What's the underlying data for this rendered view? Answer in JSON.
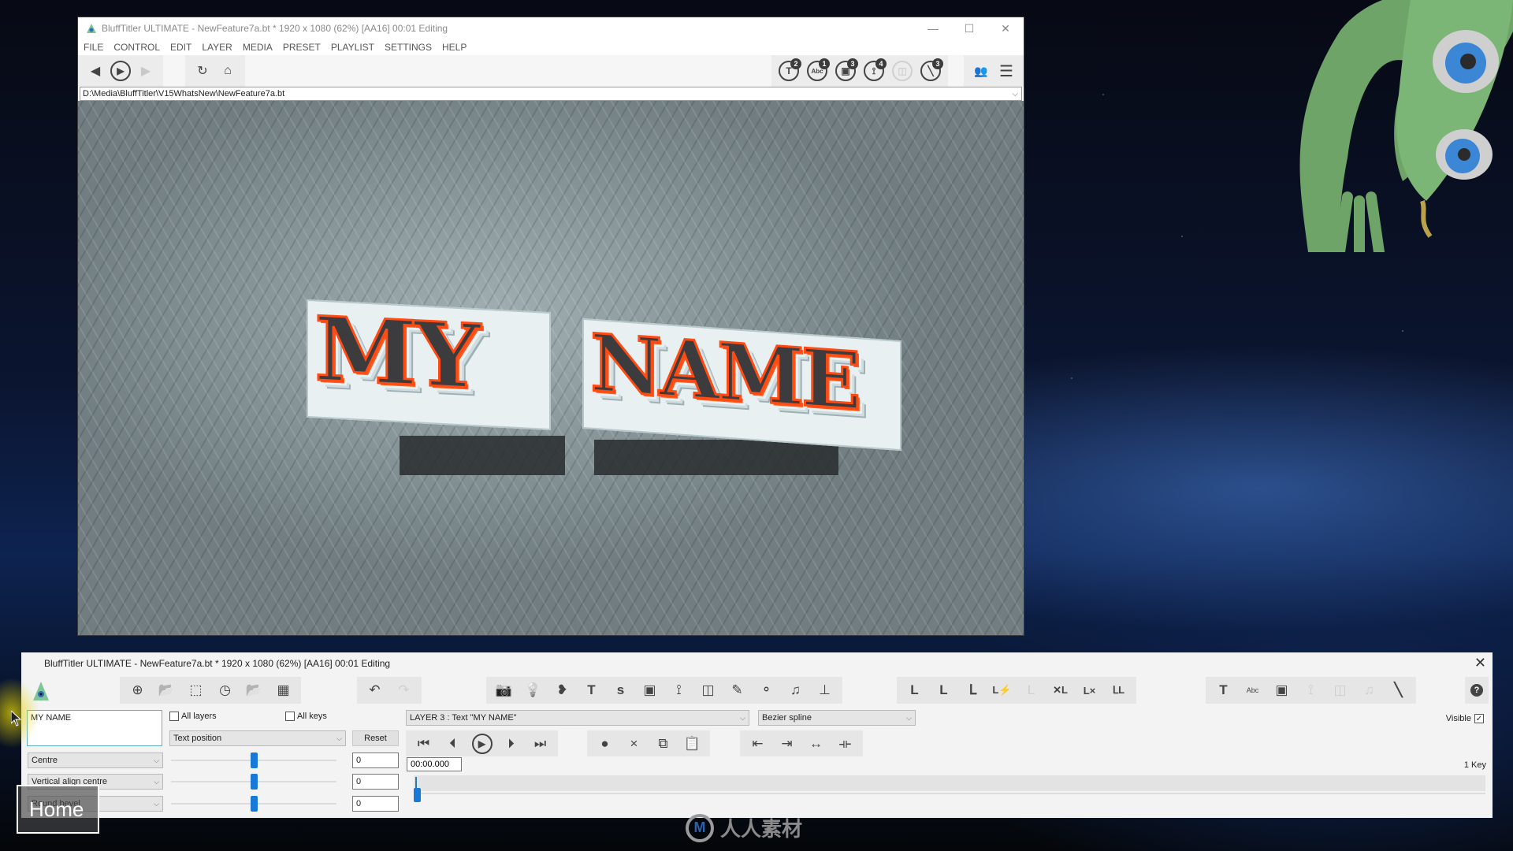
{
  "main_window": {
    "title": "BluffTitler ULTIMATE  - NewFeature7a.bt * 1920 x 1080 (62%) [AA16] 00:01 Editing",
    "menu": [
      "FILE",
      "CONTROL",
      "EDIT",
      "LAYER",
      "MEDIA",
      "PRESET",
      "PLAYLIST",
      "SETTINGS",
      "HELP"
    ],
    "window_controls": {
      "minimize": "—",
      "maximize": "☐",
      "close": "✕"
    },
    "nav_buttons": [
      {
        "name": "back",
        "glyph": "◀",
        "disabled": false
      },
      {
        "name": "play",
        "glyph": "▶",
        "disabled": false
      },
      {
        "name": "forward",
        "glyph": "▶",
        "disabled": true
      }
    ],
    "tool_buttons": [
      {
        "name": "refresh",
        "glyph": "↻"
      },
      {
        "name": "home",
        "glyph": "⌂"
      }
    ],
    "layer_counters": [
      {
        "name": "text-layers",
        "glyph": "T",
        "count": "2",
        "disabled": false
      },
      {
        "name": "abc-layers",
        "glyph": "Abc",
        "count": "1",
        "disabled": false
      },
      {
        "name": "picture-layers",
        "glyph": "▣",
        "count": "3",
        "disabled": false
      },
      {
        "name": "path-layers",
        "glyph": "⟟",
        "count": "4",
        "disabled": false
      },
      {
        "name": "model-layers",
        "glyph": "◫",
        "count": "",
        "disabled": true
      },
      {
        "name": "effect-layers",
        "glyph": "╲",
        "count": "3",
        "disabled": false
      }
    ],
    "right_buttons": [
      {
        "name": "community",
        "glyph": "👥"
      },
      {
        "name": "menu",
        "glyph": "☰"
      }
    ],
    "path": "D:\\Media\\BluffTitler\\V15WhatsNew\\NewFeature7a.bt",
    "viewport": {
      "text_line1": "MY",
      "text_line2": "NAME",
      "accent_color": "#ff4a12",
      "face_color": "#3c3c3e"
    }
  },
  "home_overlay": {
    "label": "Home"
  },
  "panel": {
    "title": "BluffTitler ULTIMATE  - NewFeature7a.bt * 1920 x 1080 (62%) [AA16] 00:01 Editing",
    "close": "✕",
    "file_tools": [
      {
        "name": "new",
        "glyph": "⊕"
      },
      {
        "name": "open",
        "glyph": "📂"
      },
      {
        "name": "frame",
        "glyph": "⬚"
      },
      {
        "name": "history",
        "glyph": "◷"
      },
      {
        "name": "import",
        "glyph": "📂"
      },
      {
        "name": "film",
        "glyph": "▦"
      }
    ],
    "edit_tools": [
      {
        "name": "undo",
        "glyph": "↶",
        "disabled": false
      },
      {
        "name": "redo",
        "glyph": "↷",
        "disabled": true
      }
    ],
    "layer_tools": [
      {
        "name": "camera",
        "glyph": "📷"
      },
      {
        "name": "light",
        "glyph": "💡"
      },
      {
        "name": "blob",
        "glyph": "❥"
      },
      {
        "name": "text",
        "glyph": "T"
      },
      {
        "name": "s-text",
        "glyph": "s"
      },
      {
        "name": "picture",
        "glyph": "▣"
      },
      {
        "name": "path",
        "glyph": "⟟"
      },
      {
        "name": "model",
        "glyph": "◫"
      },
      {
        "name": "pen",
        "glyph": "✎"
      },
      {
        "name": "particles",
        "glyph": "⚬"
      },
      {
        "name": "audio",
        "glyph": "♫"
      },
      {
        "name": "layer-base",
        "glyph": "⊥"
      }
    ],
    "layer_ops": [
      {
        "name": "layer-copy",
        "glyph": "L",
        "disabled": false
      },
      {
        "name": "layer-paste",
        "glyph": "L",
        "disabled": false
      },
      {
        "name": "layer-link",
        "glyph": "ᒪ",
        "disabled": false
      },
      {
        "name": "layer-flash",
        "glyph": "L⚡",
        "disabled": false
      },
      {
        "name": "layer-unlink",
        "glyph": "L",
        "disabled": true
      },
      {
        "name": "layer-center",
        "glyph": "✕L",
        "disabled": false
      },
      {
        "name": "layer-delete",
        "glyph": "L×",
        "disabled": false
      },
      {
        "name": "layer-child",
        "glyph": "ᒪL",
        "disabled": false
      }
    ],
    "resize_tools": [
      {
        "name": "resize-text",
        "glyph": "T",
        "disabled": false
      },
      {
        "name": "resize-abc",
        "glyph": "Abc",
        "disabled": false
      },
      {
        "name": "resize-picture",
        "glyph": "▣",
        "disabled": false
      },
      {
        "name": "resize-path",
        "glyph": "⟟",
        "disabled": true
      },
      {
        "name": "resize-model",
        "glyph": "◫",
        "disabled": true
      },
      {
        "name": "resize-audio",
        "glyph": "♫",
        "disabled": true
      },
      {
        "name": "resize-effect",
        "glyph": "╲",
        "disabled": false
      }
    ],
    "help": "?",
    "text_value": "MY NAME",
    "all_layers": {
      "label": "All layers",
      "checked": false
    },
    "all_keys": {
      "label": "All keys",
      "checked": false
    },
    "property_select": "Text position",
    "reset_label": "Reset",
    "align_select": "Centre",
    "valign_select": "Vertical align centre",
    "bevel_select": "Round bevel",
    "sliders": [
      {
        "name": "x",
        "value": "0",
        "fraction": 0.5
      },
      {
        "name": "y",
        "value": "0",
        "fraction": 0.5
      },
      {
        "name": "z",
        "value": "0",
        "fraction": 0.5
      }
    ],
    "layer_select": "LAYER 3  : Text \"MY NAME\"",
    "interpolation_select": "Bezier spline",
    "transport": [
      {
        "name": "first-key",
        "glyph": "⏮"
      },
      {
        "name": "prev-key",
        "glyph": "⏴"
      },
      {
        "name": "play",
        "glyph": "▶"
      },
      {
        "name": "next-key",
        "glyph": "⏵"
      },
      {
        "name": "last-key",
        "glyph": "⏭"
      }
    ],
    "key_tools": [
      {
        "name": "record",
        "glyph": "●"
      },
      {
        "name": "delete-key",
        "glyph": "×"
      },
      {
        "name": "copy-key",
        "glyph": "⧉"
      },
      {
        "name": "paste-key",
        "glyph": "📋"
      }
    ],
    "time_tools": [
      {
        "name": "align-start",
        "glyph": "⇤"
      },
      {
        "name": "align-end",
        "glyph": "⇥"
      },
      {
        "name": "stretch",
        "glyph": "↔"
      },
      {
        "name": "split",
        "glyph": "⟛"
      }
    ],
    "time_value": "00:00.000",
    "visible": {
      "label": "Visible",
      "checked": true
    },
    "key_count": "1 Key"
  },
  "watermark": {
    "text": "人人素材",
    "logo": "M"
  }
}
